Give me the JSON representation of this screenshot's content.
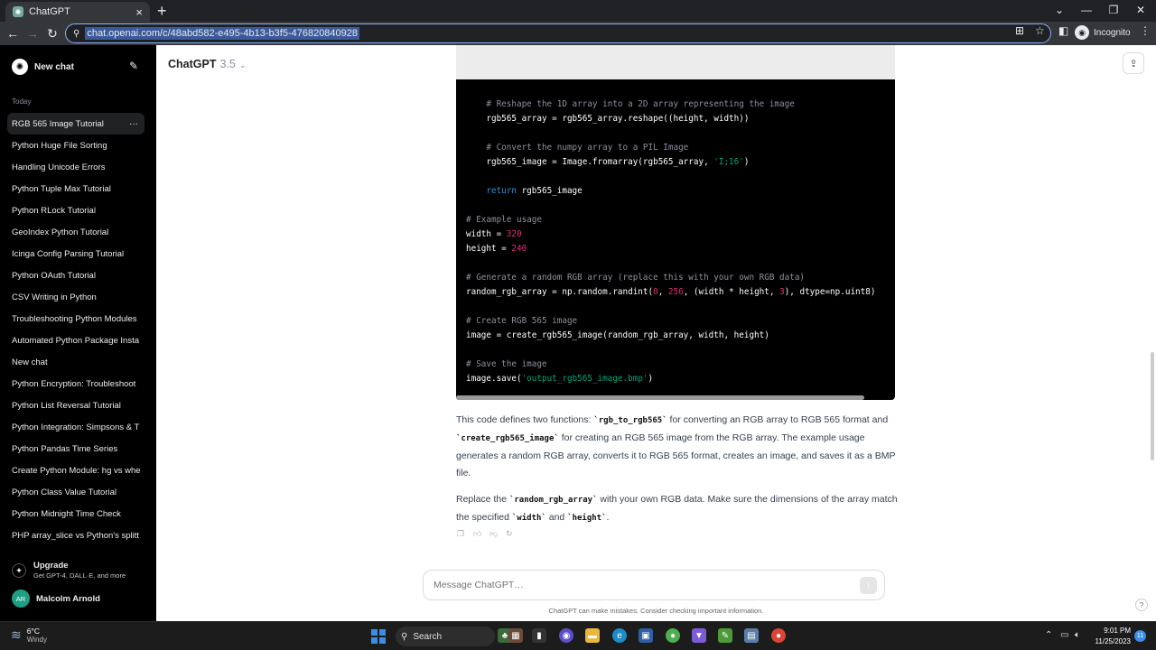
{
  "browser": {
    "tab_title": "ChatGPT",
    "url": "chat.openai.com/c/48abd582-e495-4b13-b3f5-476820840928",
    "incognito_label": "Incognito"
  },
  "sidebar": {
    "new_chat_label": "New chat",
    "section_today": "Today",
    "items": [
      {
        "label": "RGB 565 Image Tutorial"
      },
      {
        "label": "Python Huge File Sorting"
      },
      {
        "label": "Handling Unicode Errors"
      },
      {
        "label": "Python Tuple Max Tutorial"
      },
      {
        "label": "Python RLock Tutorial"
      },
      {
        "label": "GeoIndex Python Tutorial"
      },
      {
        "label": "Icinga Config Parsing Tutorial"
      },
      {
        "label": "Python OAuth Tutorial"
      },
      {
        "label": "CSV Writing in Python"
      },
      {
        "label": "Troubleshooting Python Modules"
      },
      {
        "label": "Automated Python Package Insta"
      },
      {
        "label": "New chat"
      },
      {
        "label": "Python Encryption: Troubleshoot"
      },
      {
        "label": "Python List Reversal Tutorial"
      },
      {
        "label": "Python Integration: Simpsons & T"
      },
      {
        "label": "Python Pandas Time Series"
      },
      {
        "label": "Create Python Module: hg vs whe"
      },
      {
        "label": "Python Class Value Tutorial"
      },
      {
        "label": "Python Midnight Time Check"
      },
      {
        "label": "PHP array_slice vs Python's splitt"
      }
    ],
    "upgrade_title": "Upgrade",
    "upgrade_sub": "Get GPT-4, DALL·E, and more",
    "user_initials": "AR",
    "user_name": "Malcolm Arnold"
  },
  "header": {
    "model_name": "ChatGPT",
    "model_version": "3.5"
  },
  "code_lines": [
    [
      {
        "t": "    # Reshape the 1D array into a 2D array representing the image",
        "c": "cm"
      }
    ],
    [
      {
        "t": "    rgb565_array = rgb565_array.reshape((height, width))",
        "c": ""
      }
    ],
    [],
    [
      {
        "t": "    # Convert the numpy array to a PIL Image",
        "c": "cm"
      }
    ],
    [
      {
        "t": "    rgb565_image = Image.fromarray(rgb565_array, ",
        "c": ""
      },
      {
        "t": "'I;16'",
        "c": "str"
      },
      {
        "t": ")",
        "c": ""
      }
    ],
    [],
    [
      {
        "t": "    ",
        "c": ""
      },
      {
        "t": "return",
        "c": "kw"
      },
      {
        "t": " rgb565_image",
        "c": ""
      }
    ],
    [],
    [
      {
        "t": "# Example usage",
        "c": "cm"
      }
    ],
    [
      {
        "t": "width = ",
        "c": ""
      },
      {
        "t": "320",
        "c": "num"
      }
    ],
    [
      {
        "t": "height = ",
        "c": ""
      },
      {
        "t": "240",
        "c": "num"
      }
    ],
    [],
    [
      {
        "t": "# Generate a random RGB array (replace this with your own RGB data)",
        "c": "cm"
      }
    ],
    [
      {
        "t": "random_rgb_array = np.random.randint(",
        "c": ""
      },
      {
        "t": "0",
        "c": "num"
      },
      {
        "t": ", ",
        "c": ""
      },
      {
        "t": "256",
        "c": "num"
      },
      {
        "t": ", (width * height, ",
        "c": ""
      },
      {
        "t": "3",
        "c": "num"
      },
      {
        "t": "), dtype=np.uint8)",
        "c": ""
      }
    ],
    [],
    [
      {
        "t": "# Create RGB 565 image",
        "c": "cm"
      }
    ],
    [
      {
        "t": "image = create_rgb565_image(random_rgb_array, width, height)",
        "c": ""
      }
    ],
    [],
    [
      {
        "t": "# Save the image",
        "c": "cm"
      }
    ],
    [
      {
        "t": "image.save(",
        "c": ""
      },
      {
        "t": "'output_rgb565_image.bmp'",
        "c": "str"
      },
      {
        "t": ")",
        "c": ""
      }
    ]
  ],
  "answer": {
    "p1": {
      "a": "This code defines two functions: ",
      "code1": "`rgb_to_rgb565`",
      "b": " for converting an RGB array to RGB 565 format and ",
      "code2": "`create_rgb565_image`",
      "c": " for creating an RGB 565 image from the RGB array. The example usage generates a random RGB array, converts it to RGB 565 format, creates an image, and saves it as a BMP file."
    },
    "p2": {
      "a": "Replace the ",
      "code1": "`random_rgb_array`",
      "b": " with your own RGB data. Make sure the dimensions of the array match the specified ",
      "code2": "`width`",
      "c": " and ",
      "code3": "`height`",
      "d": "."
    }
  },
  "composer": {
    "placeholder": "Message ChatGPT…"
  },
  "disclaimer": "ChatGPT can make mistakes. Consider checking important information.",
  "taskbar": {
    "temperature": "6°C",
    "condition": "Windy",
    "search_label": "Search",
    "time": "9:01 PM",
    "date": "11/25/2023",
    "notification_count": "11"
  }
}
